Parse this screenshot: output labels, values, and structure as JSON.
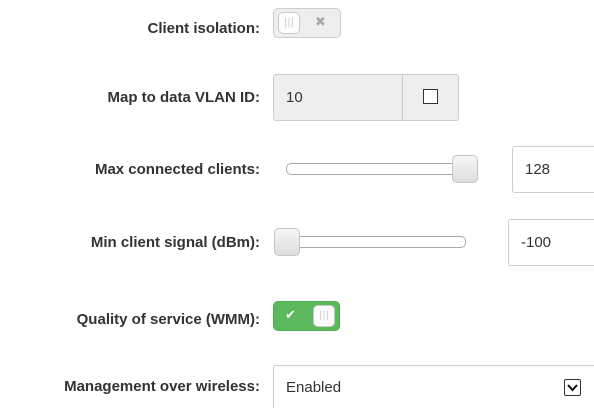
{
  "client_isolation": {
    "label": "Client isolation:",
    "state": "off",
    "off_glyph": "✖",
    "knob_glyph": "|||"
  },
  "vlan": {
    "label": "Map to data VLAN ID:",
    "value": "10",
    "checkbox_checked": false
  },
  "max_clients": {
    "label": "Max connected clients:",
    "value": "128",
    "slider_position": 1.0
  },
  "min_signal": {
    "label": "Min client signal (dBm):",
    "value": "-100",
    "slider_position": 0.0
  },
  "wmm": {
    "label": "Quality of service (WMM):",
    "state": "on",
    "on_glyph": "✔",
    "knob_glyph": "|||"
  },
  "management": {
    "label": "Management over wireless:",
    "value": "Enabled",
    "arrow_glyph": "❯"
  },
  "colors": {
    "toggle_on": "#5cb85c",
    "toggle_off": "#eeeeee",
    "label_text": "#333333"
  }
}
